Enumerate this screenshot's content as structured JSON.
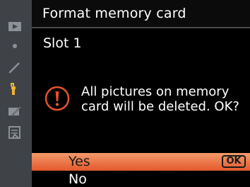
{
  "header": {
    "title": "Format memory card"
  },
  "subtitle": "Slot 1",
  "dialog": {
    "message_line1": "All pictures on memory",
    "message_line2": "card will be deleted. OK?"
  },
  "options": {
    "yes_label": "Yes",
    "no_label": "No",
    "ok_badge": "OK"
  },
  "sidebar": {
    "icons": [
      "playback-menu-icon",
      "shooting-menu-icon",
      "custom-settings-icon",
      "setup-menu-icon",
      "retouch-menu-icon",
      "my-menu-icon"
    ],
    "active": "setup-menu-icon"
  },
  "colors": {
    "selected_row": "#e4582c",
    "sidebar_bg": "#3f4347",
    "alert": "#e4532a"
  }
}
